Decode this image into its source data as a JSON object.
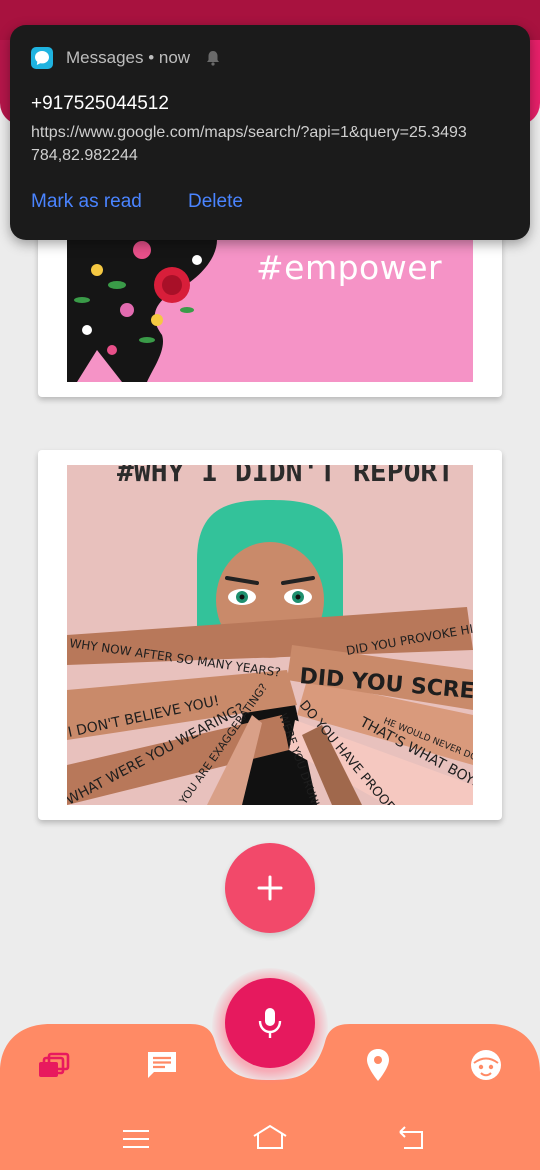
{
  "notification": {
    "app_name": "Messages",
    "time": "now",
    "meta": "Messages • now",
    "sender": "+917525044512",
    "message": "https://www.google.com/maps/search/?api=1&query=25.3493784,82.982244",
    "actions": {
      "mark_as_read": "Mark as read",
      "delete": "Delete"
    }
  },
  "cards": [
    {
      "hashtag": "#empower"
    },
    {
      "poster_title": "#WHY I DIDN'T REPORT",
      "speech_phrases": [
        "WHY NOW AFTER SO MANY YEARS?",
        "DID YOU PROVOKE HIM?",
        "DID YOU SCREAM?",
        "I DON'T BELIEVE YOU!",
        "WHAT WERE YOU WEARING?",
        "YOU ARE EXAGGERATING?",
        "WERE YOU DRUNK OR HIGH?",
        "DO YOU HAVE PROOF?",
        "THAT'S WHAT BOYS DO",
        "HE WOULD NEVER DO SOMETHING LIKE THAT"
      ]
    }
  ],
  "fab": {
    "icon": "plus-icon"
  },
  "bottom_nav": {
    "items": [
      "gallery-icon",
      "chat-icon",
      "location-pin-icon",
      "face-icon"
    ],
    "center": "mic-icon"
  },
  "system_nav": [
    "menu-icon",
    "home-icon",
    "back-icon"
  ],
  "colors": {
    "header": "#c8174f",
    "accent_pink": "#f2496a",
    "mic": "#e6195e",
    "bottom_bar": "#ff8a65",
    "notification_bg": "#1b1b1b",
    "action_blue": "#4a84ff"
  }
}
